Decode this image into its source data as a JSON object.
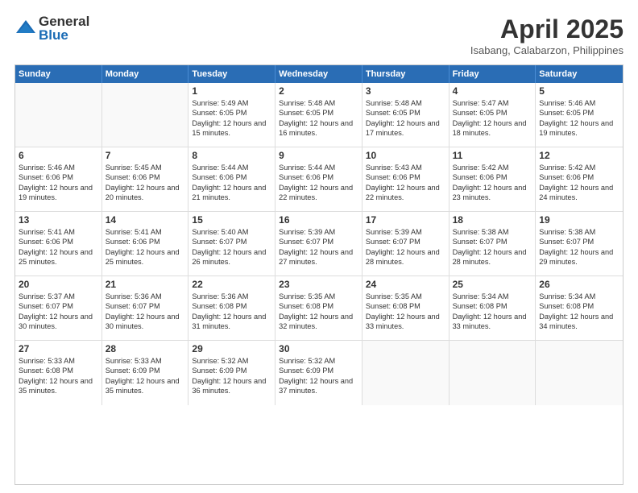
{
  "logo": {
    "general": "General",
    "blue": "Blue"
  },
  "title": "April 2025",
  "location": "Isabang, Calabarzon, Philippines",
  "weekdays": [
    "Sunday",
    "Monday",
    "Tuesday",
    "Wednesday",
    "Thursday",
    "Friday",
    "Saturday"
  ],
  "weeks": [
    [
      {
        "day": "",
        "info": ""
      },
      {
        "day": "",
        "info": ""
      },
      {
        "day": "1",
        "info": "Sunrise: 5:49 AM\nSunset: 6:05 PM\nDaylight: 12 hours and 15 minutes."
      },
      {
        "day": "2",
        "info": "Sunrise: 5:48 AM\nSunset: 6:05 PM\nDaylight: 12 hours and 16 minutes."
      },
      {
        "day": "3",
        "info": "Sunrise: 5:48 AM\nSunset: 6:05 PM\nDaylight: 12 hours and 17 minutes."
      },
      {
        "day": "4",
        "info": "Sunrise: 5:47 AM\nSunset: 6:05 PM\nDaylight: 12 hours and 18 minutes."
      },
      {
        "day": "5",
        "info": "Sunrise: 5:46 AM\nSunset: 6:05 PM\nDaylight: 12 hours and 19 minutes."
      }
    ],
    [
      {
        "day": "6",
        "info": "Sunrise: 5:46 AM\nSunset: 6:06 PM\nDaylight: 12 hours and 19 minutes."
      },
      {
        "day": "7",
        "info": "Sunrise: 5:45 AM\nSunset: 6:06 PM\nDaylight: 12 hours and 20 minutes."
      },
      {
        "day": "8",
        "info": "Sunrise: 5:44 AM\nSunset: 6:06 PM\nDaylight: 12 hours and 21 minutes."
      },
      {
        "day": "9",
        "info": "Sunrise: 5:44 AM\nSunset: 6:06 PM\nDaylight: 12 hours and 22 minutes."
      },
      {
        "day": "10",
        "info": "Sunrise: 5:43 AM\nSunset: 6:06 PM\nDaylight: 12 hours and 22 minutes."
      },
      {
        "day": "11",
        "info": "Sunrise: 5:42 AM\nSunset: 6:06 PM\nDaylight: 12 hours and 23 minutes."
      },
      {
        "day": "12",
        "info": "Sunrise: 5:42 AM\nSunset: 6:06 PM\nDaylight: 12 hours and 24 minutes."
      }
    ],
    [
      {
        "day": "13",
        "info": "Sunrise: 5:41 AM\nSunset: 6:06 PM\nDaylight: 12 hours and 25 minutes."
      },
      {
        "day": "14",
        "info": "Sunrise: 5:41 AM\nSunset: 6:06 PM\nDaylight: 12 hours and 25 minutes."
      },
      {
        "day": "15",
        "info": "Sunrise: 5:40 AM\nSunset: 6:07 PM\nDaylight: 12 hours and 26 minutes."
      },
      {
        "day": "16",
        "info": "Sunrise: 5:39 AM\nSunset: 6:07 PM\nDaylight: 12 hours and 27 minutes."
      },
      {
        "day": "17",
        "info": "Sunrise: 5:39 AM\nSunset: 6:07 PM\nDaylight: 12 hours and 28 minutes."
      },
      {
        "day": "18",
        "info": "Sunrise: 5:38 AM\nSunset: 6:07 PM\nDaylight: 12 hours and 28 minutes."
      },
      {
        "day": "19",
        "info": "Sunrise: 5:38 AM\nSunset: 6:07 PM\nDaylight: 12 hours and 29 minutes."
      }
    ],
    [
      {
        "day": "20",
        "info": "Sunrise: 5:37 AM\nSunset: 6:07 PM\nDaylight: 12 hours and 30 minutes."
      },
      {
        "day": "21",
        "info": "Sunrise: 5:36 AM\nSunset: 6:07 PM\nDaylight: 12 hours and 30 minutes."
      },
      {
        "day": "22",
        "info": "Sunrise: 5:36 AM\nSunset: 6:08 PM\nDaylight: 12 hours and 31 minutes."
      },
      {
        "day": "23",
        "info": "Sunrise: 5:35 AM\nSunset: 6:08 PM\nDaylight: 12 hours and 32 minutes."
      },
      {
        "day": "24",
        "info": "Sunrise: 5:35 AM\nSunset: 6:08 PM\nDaylight: 12 hours and 33 minutes."
      },
      {
        "day": "25",
        "info": "Sunrise: 5:34 AM\nSunset: 6:08 PM\nDaylight: 12 hours and 33 minutes."
      },
      {
        "day": "26",
        "info": "Sunrise: 5:34 AM\nSunset: 6:08 PM\nDaylight: 12 hours and 34 minutes."
      }
    ],
    [
      {
        "day": "27",
        "info": "Sunrise: 5:33 AM\nSunset: 6:08 PM\nDaylight: 12 hours and 35 minutes."
      },
      {
        "day": "28",
        "info": "Sunrise: 5:33 AM\nSunset: 6:09 PM\nDaylight: 12 hours and 35 minutes."
      },
      {
        "day": "29",
        "info": "Sunrise: 5:32 AM\nSunset: 6:09 PM\nDaylight: 12 hours and 36 minutes."
      },
      {
        "day": "30",
        "info": "Sunrise: 5:32 AM\nSunset: 6:09 PM\nDaylight: 12 hours and 37 minutes."
      },
      {
        "day": "",
        "info": ""
      },
      {
        "day": "",
        "info": ""
      },
      {
        "day": "",
        "info": ""
      }
    ]
  ]
}
